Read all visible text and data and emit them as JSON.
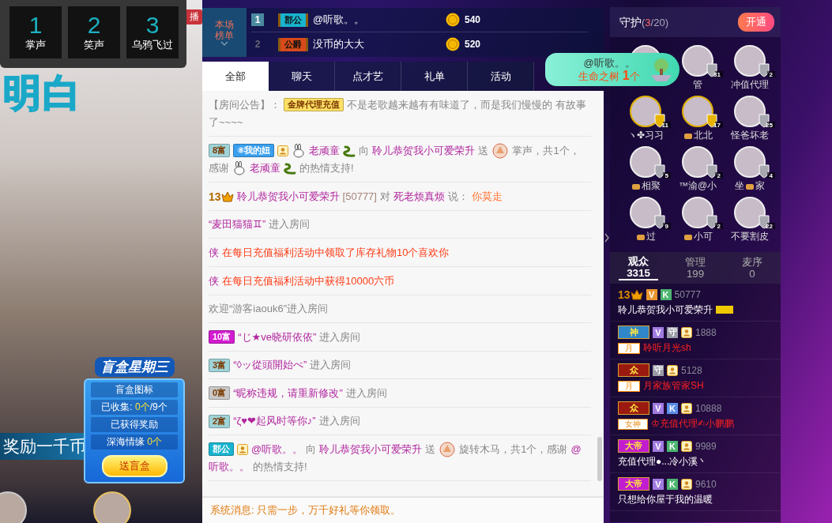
{
  "video": {
    "caption": "明白",
    "live_tag": "播",
    "banner": "奖励一千币"
  },
  "gift_shortcuts": [
    {
      "number": "1",
      "label": "掌声"
    },
    {
      "number": "2",
      "label": "笑声"
    },
    {
      "number": "3",
      "label": "乌鸦飞过"
    }
  ],
  "blind_box": {
    "title": "盲盒星期三",
    "rows": [
      "盲盒图标",
      "已收集: **0个**/9个",
      "已获得奖励",
      "深海情缘 **0个**"
    ],
    "button": "送盲盒"
  },
  "rank_board": {
    "label": "本场榜单",
    "rows": [
      {
        "rank": "1",
        "highlighted": true,
        "badge": {
          "text": "郡公",
          "color": "#18b4d0"
        },
        "name": "@听歌。。",
        "coins": "540"
      },
      {
        "rank": "2",
        "highlighted": false,
        "badge": {
          "text": "公爵",
          "color": "#d84a1a"
        },
        "name": "没币的大大",
        "coins": "520"
      }
    ]
  },
  "chat": {
    "tabs": [
      {
        "label": "全部",
        "selected": true
      },
      {
        "label": "聊天",
        "selected": false
      },
      {
        "label": "点才艺",
        "selected": false
      },
      {
        "label": "礼单",
        "selected": false
      },
      {
        "label": "活动",
        "selected": false
      }
    ],
    "messages": [
      {
        "parts": [
          {
            "kind": "plain",
            "text": "【房间公告】："
          },
          {
            "kind": "badge",
            "text": "金牌代理充值",
            "color": "#ffe066"
          },
          {
            "kind": "plain",
            "text": "不是老歌越来越有有味道了，而是我们慢慢的 有故事"
          },
          {
            "kind": "plain",
            "text": "了~~~~"
          }
        ]
      },
      {
        "parts": [
          {
            "kind": "badge",
            "text": "8富",
            "color": "#9fd3d8"
          },
          {
            "kind": "badge",
            "text": "⑧我的妞",
            "color": "#3aa0f0"
          },
          {
            "kind": "user-icon"
          },
          {
            "kind": "rabbit-icon"
          },
          {
            "kind": "user",
            "text": "老顽童"
          },
          {
            "kind": "snake-icon"
          },
          {
            "kind": "plain",
            "text": "向"
          },
          {
            "kind": "user",
            "text": "聆儿恭贺我小可爱荣升"
          },
          {
            "kind": "plain",
            "text": "送"
          },
          {
            "kind": "gift-icon"
          },
          {
            "kind": "plain",
            "text": "掌声，共1个，"
          },
          {
            "kind": "plain",
            "text": "感谢"
          },
          {
            "kind": "rabbit-icon"
          },
          {
            "kind": "user",
            "text": "老顽童"
          },
          {
            "kind": "snake-icon"
          },
          {
            "kind": "plain",
            "text": "的热情支持!"
          }
        ]
      },
      {
        "parts": [
          {
            "kind": "level",
            "text": "13"
          },
          {
            "kind": "user",
            "text": "聆儿恭贺我小可爱荣升"
          },
          {
            "kind": "id",
            "text": "[50777]"
          },
          {
            "kind": "plain",
            "text": "对"
          },
          {
            "kind": "user",
            "text": "死老烦真烦"
          },
          {
            "kind": "plain",
            "text": "说："
          },
          {
            "kind": "speech",
            "text": "你莫走"
          }
        ]
      },
      {
        "parts": [
          {
            "kind": "user",
            "text": "“麦田猫猫♊”"
          },
          {
            "kind": "plain",
            "text": "进入房间"
          }
        ]
      },
      {
        "parts": [
          {
            "kind": "user",
            "text": "侠"
          },
          {
            "kind": "alert",
            "text": "在每日充值福利活动中领取了库存礼物10个喜欢你"
          }
        ]
      },
      {
        "parts": [
          {
            "kind": "user",
            "text": "侠"
          },
          {
            "kind": "alert",
            "text": "在每日充值福利活动中获得10000六币"
          }
        ]
      },
      {
        "parts": [
          {
            "kind": "plain",
            "text": "欢迎“游客iaouk6”进入房间"
          }
        ]
      },
      {
        "parts": [
          {
            "kind": "badge",
            "text": "10富",
            "color": "#d21ccf"
          },
          {
            "kind": "user",
            "text": "“じ★ve晓研依依”"
          },
          {
            "kind": "plain",
            "text": "进入房间"
          }
        ]
      },
      {
        "parts": [
          {
            "kind": "badge",
            "text": "3富",
            "color": "#9fd3d8"
          },
          {
            "kind": "user",
            "text": "“◊ッ從頭開始ぺ”"
          },
          {
            "kind": "plain",
            "text": "进入房间"
          }
        ]
      },
      {
        "parts": [
          {
            "kind": "badge",
            "text": "0富",
            "color": "#c8c8c8"
          },
          {
            "kind": "user",
            "text": "“昵称违规，请重新修改”"
          },
          {
            "kind": "plain",
            "text": "进入房间"
          }
        ]
      },
      {
        "parts": [
          {
            "kind": "badge",
            "text": "2富",
            "color": "#9fd3d8"
          },
          {
            "kind": "user",
            "text": "“ζ♥❤起风时等你♪”"
          },
          {
            "kind": "plain",
            "text": "进入房间"
          }
        ]
      },
      {
        "parts": [
          {
            "kind": "badge",
            "text": "郡公",
            "color": "#18b4d0"
          },
          {
            "kind": "user-icon"
          },
          {
            "kind": "user",
            "text": "@听歌。。"
          },
          {
            "kind": "plain",
            "text": "向"
          },
          {
            "kind": "user",
            "text": "聆儿恭贺我小可爱荣升"
          },
          {
            "kind": "plain",
            "text": "送"
          },
          {
            "kind": "gift-icon"
          },
          {
            "kind": "plain",
            "text": "旋转木马，共1个，感谢"
          },
          {
            "kind": "user",
            "text": "@"
          },
          {
            "kind": "user",
            "text": "听歌。。"
          },
          {
            "kind": "plain",
            "text": "的热情支持!"
          }
        ]
      }
    ],
    "system_message": "系统消息: 只需一步，万千好礼等你领取。"
  },
  "gift_notice": {
    "user": "@听歌。。",
    "gift": "生命之树 **1**个"
  },
  "guard": {
    "title": "守护",
    "count": "(**3**/20)",
    "button": "开通",
    "members": [
      {
        "kind": "silver"
      },
      {
        "kind": "silver",
        "level": "31",
        "name": [
          {
            "kind": "text",
            "text": "管"
          }
        ]
      },
      {
        "kind": "silver",
        "level": "2",
        "name": [
          {
            "kind": "text",
            "text": "冲值代理"
          }
        ]
      },
      {
        "kind": "gold",
        "level": "11",
        "name": [
          {
            "kind": "text",
            "text": "ヽ✤习习"
          }
        ]
      },
      {
        "kind": "gold",
        "level": "17",
        "name": [
          {
            "kind": "icon"
          },
          {
            "kind": "text",
            "text": "北北"
          }
        ]
      },
      {
        "kind": "silver",
        "level": "25",
        "name": [
          {
            "kind": "text",
            "text": "怪爸坏老"
          }
        ]
      },
      {
        "kind": "silver",
        "level": "5",
        "name": [
          {
            "kind": "icon"
          },
          {
            "kind": "text",
            "text": "相聚"
          }
        ]
      },
      {
        "kind": "silver",
        "level": "2",
        "name": [
          {
            "kind": "text",
            "text": "™渝@小"
          }
        ]
      },
      {
        "kind": "silver",
        "level": "4",
        "name": [
          {
            "kind": "text",
            "text": "坐"
          },
          {
            "kind": "icon"
          },
          {
            "kind": "text",
            "text": "家"
          }
        ]
      },
      {
        "kind": "silver",
        "level": "9",
        "name": [
          {
            "kind": "icon"
          },
          {
            "kind": "text",
            "text": "过"
          }
        ]
      },
      {
        "kind": "silver",
        "level": "2",
        "name": [
          {
            "kind": "icon"
          },
          {
            "kind": "text",
            "text": "小可"
          }
        ]
      },
      {
        "kind": "silver",
        "level": "22",
        "name": [
          {
            "kind": "text",
            "text": "不要割皮"
          }
        ]
      }
    ]
  },
  "audience": {
    "tabs": [
      {
        "label": "观众",
        "count": "3315",
        "selected": true
      },
      {
        "label": "管理",
        "count": "199",
        "selected": false
      },
      {
        "label": "麦序",
        "count": "0",
        "selected": false
      }
    ],
    "rows": [
      {
        "badge": {
          "kind": "level",
          "text": "13"
        },
        "tags": [
          {
            "kind": "letter",
            "text": "V",
            "color": "#e8952f"
          },
          {
            "kind": "letter",
            "text": "K",
            "color": "#4bb56f"
          }
        ],
        "id": "50777",
        "name": "聆儿恭贺我小可爱荣升",
        "highlighted": false,
        "medal": true
      },
      {
        "badge": {
          "kind": "rank",
          "text": "神",
          "color": "#2f86c8"
        },
        "tags": [
          {
            "kind": "letter",
            "text": "V",
            "color": "#a07be0"
          },
          {
            "kind": "letter",
            "text": "守",
            "color": "#9a9aa6"
          },
          {
            "kind": "user"
          }
        ],
        "id": "1888",
        "name_tag": {
          "text": "月",
          "color": "#ff8a00"
        },
        "name": "聆听月光sh",
        "highlighted": true
      },
      {
        "badge": {
          "kind": "rank",
          "text": "众",
          "color": "#9a1a10"
        },
        "tags": [
          {
            "kind": "letter",
            "text": "守",
            "color": "#9a9aa6"
          },
          {
            "kind": "user"
          }
        ],
        "id": "5128",
        "name_tag": {
          "text": "月",
          "color": "#ff8a00"
        },
        "name": "月家族管家SH",
        "highlighted": true
      },
      {
        "badge": {
          "kind": "rank",
          "text": "众",
          "color": "#9a1a10"
        },
        "tags": [
          {
            "kind": "letter",
            "text": "V",
            "color": "#a07be0"
          },
          {
            "kind": "letter",
            "text": "K",
            "color": "#5b8fe6"
          },
          {
            "kind": "user"
          }
        ],
        "id": "10888",
        "name_tag": {
          "text": "女神",
          "color": "#e8901a"
        },
        "name": "♔充值代理✍小鹏鹏",
        "highlighted": true
      },
      {
        "badge": {
          "kind": "rank",
          "text": "大帝",
          "color": "#c21ccf"
        },
        "tags": [
          {
            "kind": "letter",
            "text": "V",
            "color": "#a07be0"
          },
          {
            "kind": "letter",
            "text": "K",
            "color": "#4bb56f"
          },
          {
            "kind": "user"
          }
        ],
        "id": "9989",
        "name": "充值代理●...冷小溪丶",
        "highlighted": false
      },
      {
        "badge": {
          "kind": "rank",
          "text": "大帝",
          "color": "#c21ccf"
        },
        "tags": [
          {
            "kind": "letter",
            "text": "V",
            "color": "#a07be0"
          },
          {
            "kind": "letter",
            "text": "K",
            "color": "#4bb56f"
          },
          {
            "kind": "user"
          }
        ],
        "id": "9610",
        "name": "只想给你屋于我的温暖",
        "highlighted": false
      }
    ]
  }
}
